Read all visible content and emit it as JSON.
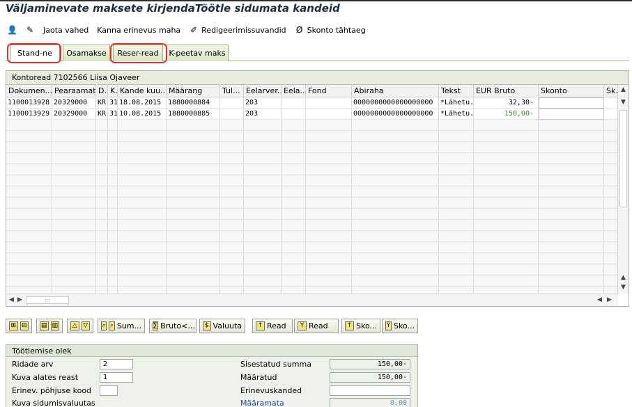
{
  "window": {
    "title": "Väljaminevate maksete kirjendaTöötle sidumata kandeid"
  },
  "toolbar": {
    "items": [
      {
        "label": "Jaota vahed",
        "icon": "split-icon"
      },
      {
        "label": "Kanna erinevus maha",
        "icon": ""
      },
      {
        "label": "Redigeerimissuvandid",
        "icon": "pencil-icon"
      },
      {
        "label": "Skonto tähtaeg",
        "icon": "null-icon"
      }
    ]
  },
  "tabs": [
    {
      "label": "Stand-ne",
      "active": true
    },
    {
      "label": "Osamakse",
      "active": false
    },
    {
      "label": "Reser-read",
      "active": false
    },
    {
      "label": "K-peetav maks",
      "active": false
    }
  ],
  "panel": {
    "title": "Kontoread 7102566 Liisa Ojaveer",
    "columns": [
      "Dokumen...",
      "Pearaamat...",
      "D..",
      "K..",
      "Kande kuu...",
      "Määrang",
      "Tul...",
      "Eelarver...",
      "Eela...",
      "Fond",
      "Abiraha",
      "Tekst",
      "EUR Bruto",
      "Skonto",
      "Sk."
    ],
    "rows": [
      {
        "doc": "1100013928",
        "gl": "20329000",
        "d": "KR",
        "k": "31",
        "date": "18.08.2015",
        "assignment": "1880000884",
        "budget": "203",
        "subsidy": "0000000000000000000",
        "text": "*Lähetu...",
        "gross": "32,30-",
        "green": false
      },
      {
        "doc": "1100013929",
        "gl": "20329000",
        "d": "KR",
        "k": "31",
        "date": "10.08.2015",
        "assignment": "1880000885",
        "budget": "203",
        "subsidy": "0000000000000000000",
        "text": "*Lähetu...",
        "gross": "150,00-",
        "green": true
      }
    ]
  },
  "buttons": [
    {
      "label": "Sum...",
      "icon": "sum-icon"
    },
    {
      "label": "Bruto<...",
      "icon": "gross-icon"
    },
    {
      "label": "Valuuta",
      "icon": "currency-icon"
    },
    {
      "label": "Read",
      "icon": "select-lines-icon"
    },
    {
      "label": "Read",
      "icon": "filter-lines-icon"
    },
    {
      "label": "Sko...",
      "icon": "discount-icon"
    },
    {
      "label": "Sko...",
      "icon": "discount-filter-icon"
    }
  ],
  "status": {
    "title": "Töötlemise olek",
    "rows_label": "Ridade arv",
    "rows_value": "2",
    "start_label": "Kuva alates reast",
    "start_value": "1",
    "reason_label": "Erinev. põhjuse kood",
    "reason_value": "",
    "currency_label": "Kuva sidumisvaluutas",
    "entered_label": "Sisestatud summa",
    "entered_value": "150,00-",
    "assigned_label": "Määratud",
    "assigned_value": "150,00-",
    "diff_label": "Erinevuskanded",
    "diff_value": "",
    "unassigned_label": "Määramata",
    "unassigned_value": "0,00"
  },
  "colors": {
    "highlight_ring": "#e53030",
    "tab_green": "#9bb46f",
    "amount_green": "#3a8a2a",
    "link_blue": "#1f4fbf"
  }
}
